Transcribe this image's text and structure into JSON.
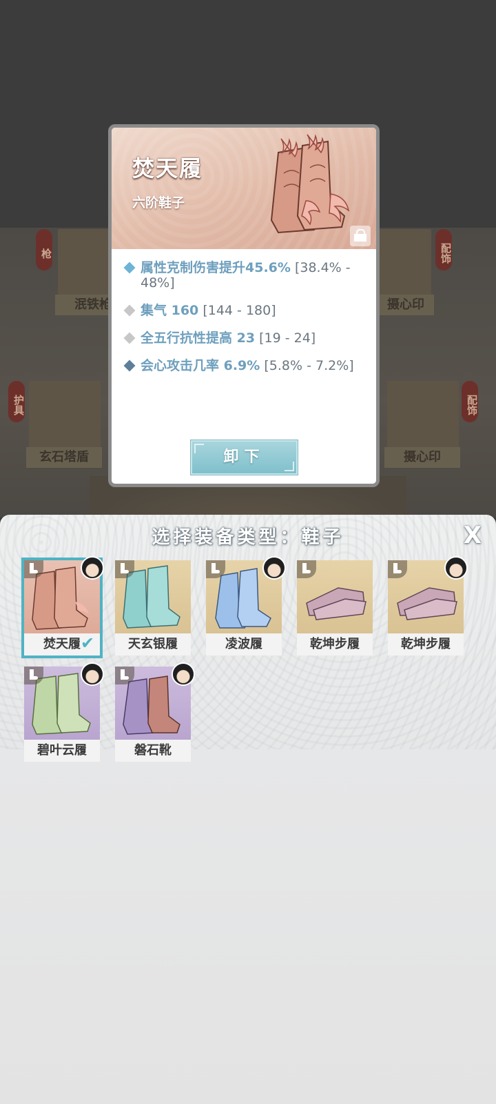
{
  "background": {
    "slots": [
      {
        "label": "泯铁枪",
        "tag": "枪"
      },
      {
        "label": "摄心印",
        "tag": "配饰"
      },
      {
        "label": "玄石塔盾",
        "tag": "护具"
      },
      {
        "label": "摄心印",
        "tag": "配饰"
      }
    ]
  },
  "detail": {
    "name": "焚天履",
    "tier": "六阶鞋子",
    "stats": [
      {
        "marker": "blue",
        "name": "属性克制伤害提升45.6%",
        "range": "[38.4% - 48%]"
      },
      {
        "marker": "grey",
        "name": "集气 160",
        "range": "[144 - 180]"
      },
      {
        "marker": "grey",
        "name": "全五行抗性提高 23",
        "range": "[19 - 24]"
      },
      {
        "marker": "navy",
        "name": "会心攻击几率 6.9%",
        "range": "[5.8% - 7.2%]"
      }
    ],
    "unload_label": "卸下"
  },
  "sheet": {
    "title": "选择装备类型：鞋子",
    "close_label": "X",
    "items": [
      {
        "label": "焚天履",
        "color": "pink",
        "selected": true,
        "has_owner": true
      },
      {
        "label": "天玄银履",
        "color": "tan",
        "selected": false,
        "has_owner": false
      },
      {
        "label": "凌波履",
        "color": "tan",
        "selected": false,
        "has_owner": true
      },
      {
        "label": "乾坤步履",
        "color": "tan",
        "selected": false,
        "has_owner": false
      },
      {
        "label": "乾坤步履",
        "color": "tan",
        "selected": false,
        "has_owner": true
      },
      {
        "label": "碧叶云履",
        "color": "lilac",
        "selected": false,
        "has_owner": true
      },
      {
        "label": "磐石靴",
        "color": "lilac",
        "selected": false,
        "has_owner": true
      }
    ]
  }
}
